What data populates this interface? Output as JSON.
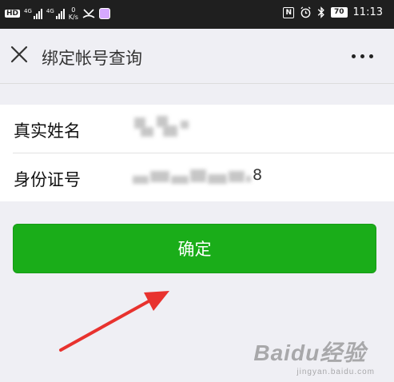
{
  "status_bar": {
    "hd": "HD",
    "signal1_label": "4G",
    "signal2_label": "4G",
    "speed_value": "0",
    "speed_unit": "K/s",
    "nfc": "N",
    "battery": "70",
    "time": "11:13"
  },
  "nav": {
    "title": "绑定帐号查询"
  },
  "form": {
    "name_label": "真实姓名",
    "id_label": "身份证号",
    "id_tail": "8"
  },
  "confirm_label": "确定",
  "watermark": {
    "main": "Baidu经验",
    "sub": "jingyan.baidu.com"
  },
  "colors": {
    "primary_button": "#1aad19",
    "annotation_arrow": "#e8322e"
  }
}
